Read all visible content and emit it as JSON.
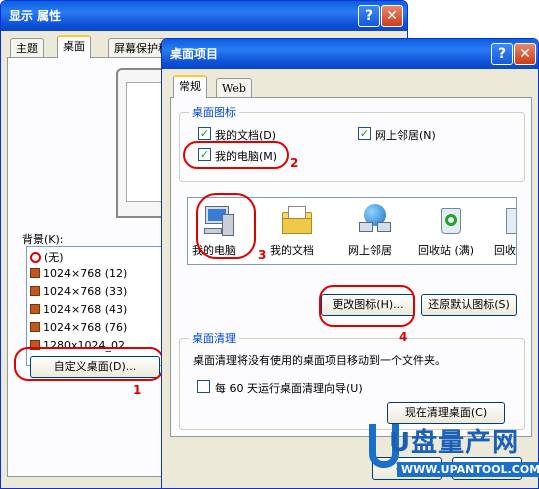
{
  "back_window": {
    "title": "显示 属性",
    "help_btn": "?",
    "close_btn": "✕",
    "tabs": [
      "主题",
      "桌面",
      "屏幕保护程"
    ],
    "background_label": "背景(K):",
    "bg_items": [
      {
        "label": "(无)",
        "type": "none"
      },
      {
        "label": "1024×768 (12)",
        "type": "img"
      },
      {
        "label": "1024×768 (33)",
        "type": "img"
      },
      {
        "label": "1024×768 (43)",
        "type": "img"
      },
      {
        "label": "1024×768 (76)",
        "type": "img"
      },
      {
        "label": "1280x1024_02",
        "type": "img"
      }
    ],
    "customize_btn": "自定义桌面(D)..."
  },
  "front_window": {
    "title": "桌面项目",
    "help_btn": "?",
    "close_btn": "✕",
    "tabs": [
      "常规",
      "Web"
    ],
    "desktop_icons_group": "桌面图标",
    "checkboxes": [
      {
        "label": "我的文档(D)",
        "checked": true
      },
      {
        "label": "网上邻居(N)",
        "checked": true
      },
      {
        "label": "我的电脑(M)",
        "checked": true
      }
    ],
    "icons": [
      "我的电脑",
      "我的文档",
      "网上邻居",
      "回收站 (满)",
      "回收"
    ],
    "change_icon_btn": "更改图标(H)...",
    "restore_default_btn": "还原默认图标(S)",
    "cleanup_group": "桌面清理",
    "cleanup_desc": "桌面清理将没有使用的桌面项目移动到一个文件夹。",
    "cleanup_check": "每 60 天运行桌面清理向导(U)",
    "cleanup_now_btn": "现在清理桌面(C)",
    "ok_btn": "确定",
    "cancel_btn": "取消"
  },
  "annotations": [
    "1",
    "2",
    "3",
    "4"
  ],
  "watermark": {
    "brand": "U盘量产网",
    "url": "WWW.UPANTOOL.COM"
  }
}
